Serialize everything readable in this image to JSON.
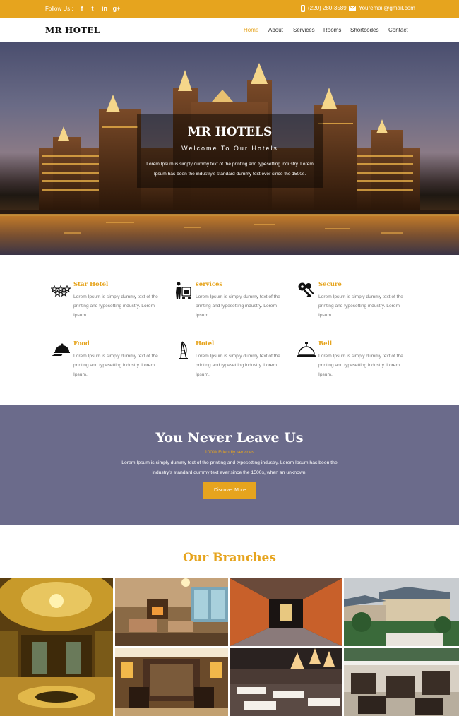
{
  "topbar": {
    "follow_label": "Follow Us :",
    "social": [
      {
        "icon": "facebook-icon",
        "glyph": "f"
      },
      {
        "icon": "twitter-icon",
        "glyph": "t"
      },
      {
        "icon": "linkedin-icon",
        "glyph": "in"
      },
      {
        "icon": "googleplus-icon",
        "glyph": "g+"
      }
    ],
    "phone": "(220) 280-3589",
    "email": "Youremail@gmail.com"
  },
  "nav": {
    "logo": "MR HOTEL",
    "items": [
      "Home",
      "About",
      "Services",
      "Rooms",
      "Shortcodes",
      "Contact"
    ],
    "active": "Home"
  },
  "hero": {
    "title": "MR HOTELS",
    "subtitle": "Welcome To Our Hotels",
    "text": "Lorem Ipsum is simply dummy text of the printing and typesetting industry. Lorem Ipsum has been the industry's standard dummy text ever since the 1500s."
  },
  "services": [
    {
      "icon": "stars-icon",
      "title": "Star Hotel",
      "text": "Lorem Ipsum is simply dummy text of the printing and typesetting industry. Lorem Ipsum."
    },
    {
      "icon": "bellboy-icon",
      "title": "services",
      "text": "Lorem Ipsum is simply dummy text of the printing and typesetting industry. Lorem Ipsum."
    },
    {
      "icon": "keys-icon",
      "title": "Secure",
      "text": "Lorem Ipsum is simply dummy text of the printing and typesetting industry. Lorem Ipsum."
    },
    {
      "icon": "food-cloche-icon",
      "title": "Food",
      "text": "Lorem Ipsum is simply dummy text of the printing and typesetting industry. Lorem Ipsum."
    },
    {
      "icon": "hotel-tower-icon",
      "title": "Hotel",
      "text": "Lorem Ipsum is simply dummy text of the printing and typesetting industry. Lorem Ipsum."
    },
    {
      "icon": "service-bell-icon",
      "title": "Bell",
      "text": "Lorem Ipsum is simply dummy text of the printing and typesetting industry. Lorem Ipsum."
    }
  ],
  "banner": {
    "title": "You Never Leave Us",
    "subtitle": "100% Friendly services",
    "text": "Lorem Ipsum is simply dummy text of the printing and typesetting industry. Lorem Ipsum has been the industry's standard dummy text ever since the 1500s, when an unknown.",
    "button": "Discover More"
  },
  "branches": {
    "title": "Our Branches",
    "photos": [
      "golden-lobby",
      "lounge-fireplace",
      "orange-hallway",
      "resort-exterior",
      "lobby-lamps",
      "dining-hall",
      "patio-seating"
    ]
  },
  "colors": {
    "accent": "#e6a41e",
    "banner_bg": "#6b6b8b",
    "text": "#333333"
  }
}
